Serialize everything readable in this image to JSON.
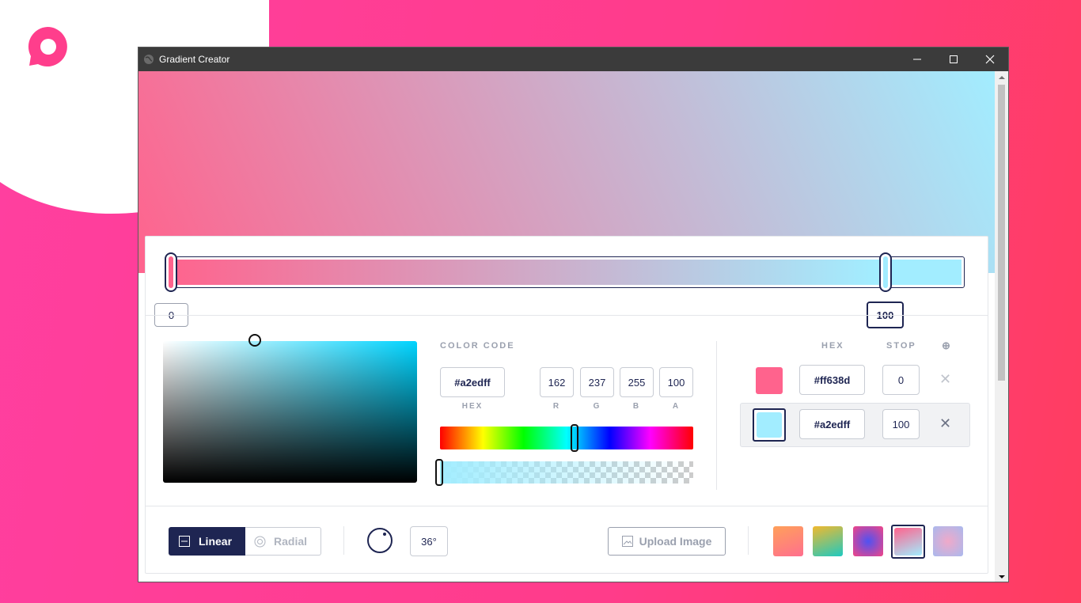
{
  "window": {
    "title": "Gradient Creator"
  },
  "gradient": {
    "type": "linear",
    "angle_label": "36°",
    "stops": [
      {
        "hex": "#ff638d",
        "stop": "0"
      },
      {
        "hex": "#a2edff",
        "stop": "100"
      }
    ]
  },
  "color_code": {
    "heading": "COLOR CODE",
    "hex": "#a2edff",
    "r": "162",
    "g": "237",
    "b": "255",
    "a": "100",
    "labels": {
      "hex": "HEX",
      "r": "R",
      "g": "G",
      "b": "B",
      "a": "A"
    },
    "hue_fraction": 0.53,
    "alpha_fraction": 1.0
  },
  "stops_table": {
    "hex_header": "HEX",
    "stop_header": "STOP",
    "add_icon": "⊕",
    "delete_icon": "✕"
  },
  "toolbar": {
    "linear_label": "Linear",
    "radial_label": "Radial",
    "upload_label": "Upload Image"
  },
  "presets": [
    {
      "from": "#ffa05a",
      "to": "#ff6f8e"
    },
    {
      "from": "#f2b92e",
      "to": "#1ec9c0"
    },
    {
      "from": "#f24586",
      "to": "#4f52f2"
    },
    {
      "from": "#ff638d",
      "to": "#a2edff"
    },
    {
      "from": "#a9b9ee",
      "to": "#f0a9c9"
    }
  ]
}
